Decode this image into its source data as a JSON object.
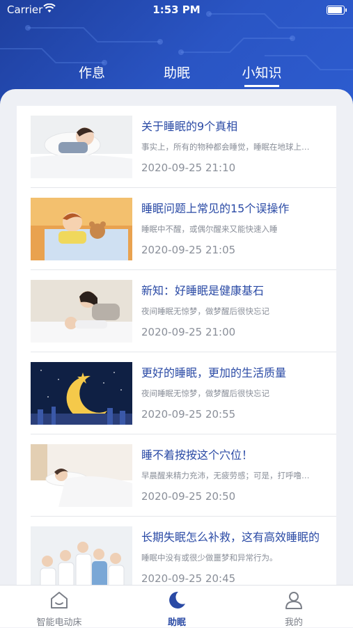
{
  "status_bar": {
    "carrier": "Carrier",
    "time": "1:53 PM"
  },
  "top_tabs": [
    {
      "label": "作息",
      "active": false
    },
    {
      "label": "助眠",
      "active": false
    },
    {
      "label": "小知识",
      "active": true
    }
  ],
  "articles": [
    {
      "title": "关于睡眠的9个真相",
      "summary": "事实上，所有的物种都会睡觉，睡眠在地球上…",
      "date": "2020-09-25 21:10",
      "thumb_icon": "child-sleeping-image"
    },
    {
      "title": "睡眠问题上常见的15个误操作",
      "summary": "睡眠中不醒，或偶尔醒来又能快速入睡",
      "date": "2020-09-25 21:05",
      "thumb_icon": "cartoon-child-bear-image"
    },
    {
      "title": "新知：好睡眠是健康基石",
      "summary": "夜间睡眠无惊梦，做梦醒后很快忘记",
      "date": "2020-09-25 21:00",
      "thumb_icon": "mother-child-image"
    },
    {
      "title": "更好的睡眠，更加的生活质量",
      "summary": "夜间睡眠无惊梦，做梦醒后很快忘记",
      "date": "2020-09-25 20:55",
      "thumb_icon": "moon-night-image"
    },
    {
      "title": "睡不着按按这个穴位！",
      "summary": "早晨醒来精力充沛，无疲劳感；可是，打呼噜…",
      "date": "2020-09-25 20:50",
      "thumb_icon": "woman-sleeping-image"
    },
    {
      "title": "长期失眠怎么补救，这有高效睡眠的",
      "summary": "睡眠中没有或很少做噩梦和异常行为。",
      "date": "2020-09-25 20:45",
      "thumb_icon": "doctors-image"
    }
  ],
  "bottom_tabs": [
    {
      "label": "智能电动床",
      "icon": "home-bed-icon",
      "active": false
    },
    {
      "label": "助眠",
      "icon": "moon-icon",
      "active": true
    },
    {
      "label": "我的",
      "icon": "person-icon",
      "active": false
    }
  ],
  "colors": {
    "header_blue": "#2a55c4",
    "accent": "#2a4aa5",
    "muted_text": "#8a8f99"
  }
}
